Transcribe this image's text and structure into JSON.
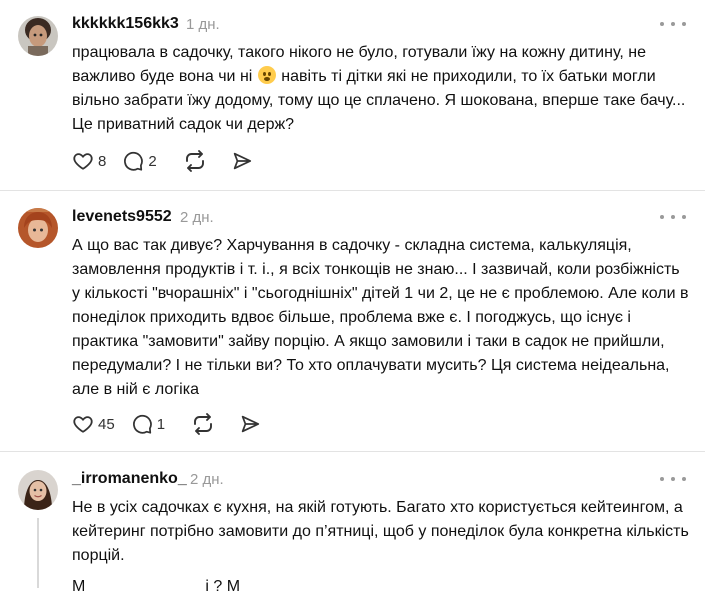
{
  "comments": [
    {
      "username": "kkkkkk156kk3",
      "time": "1 дн.",
      "text_before_emoji": "працювала в садочку, такого нікого не було, готували їжу на кожну дитину, не важливо буде вона чи ні",
      "emoji": "flushed-face",
      "text_after_emoji": " навіть ті дітки які не приходили, то їх батьки могли вільно забрати їжу додому, тому що це сплачено. Я шокована, вперше таке бачу... Це приватний садок чи держ?",
      "likes": "8",
      "replies": "2"
    },
    {
      "username": "levenets9552",
      "time": "2 дн.",
      "text": "А що вас так дивує? Харчування в садочку - складна система, калькуляція, замовлення продуктів і т. і., я всіх тонкощів не знаю... І зазвичай, коли розбіжність у кількості \"вчорашніх\" і \"сьогоднішніх\" дітей 1 чи 2, це не є проблемою. Але коли в понеділок приходить вдвоє більше, проблема вже є. І погоджусь, що існує і практика \"замовити\" зайву порцію. А якщо замовили і таки в садок не прийшли, передумали? І не тільки ви? То хто оплачувати мусить? Ця система неідеальна, але в ній є логіка",
      "likes": "45",
      "replies": "1"
    },
    {
      "username": "_irromanenko_",
      "time": "2 дн.",
      "text": "Не в усіх садочках є кухня, на якій готують. Багато хто користується кейтеингом, а кейтеринг потрібно замовити до п’ятниці, щоб у понеділок була конкретна кількість порцій.",
      "text_partial": "М                           і ? М"
    }
  ],
  "icons": {
    "like": "heart-outline-icon",
    "reply": "speech-bubble-icon",
    "repost": "repost-arrows-icon",
    "share": "paper-plane-icon",
    "more": "ellipsis-icon"
  },
  "colors": {
    "text": "#101010",
    "muted": "#999999",
    "divider": "#e3e3e3",
    "icon": "#333333"
  }
}
